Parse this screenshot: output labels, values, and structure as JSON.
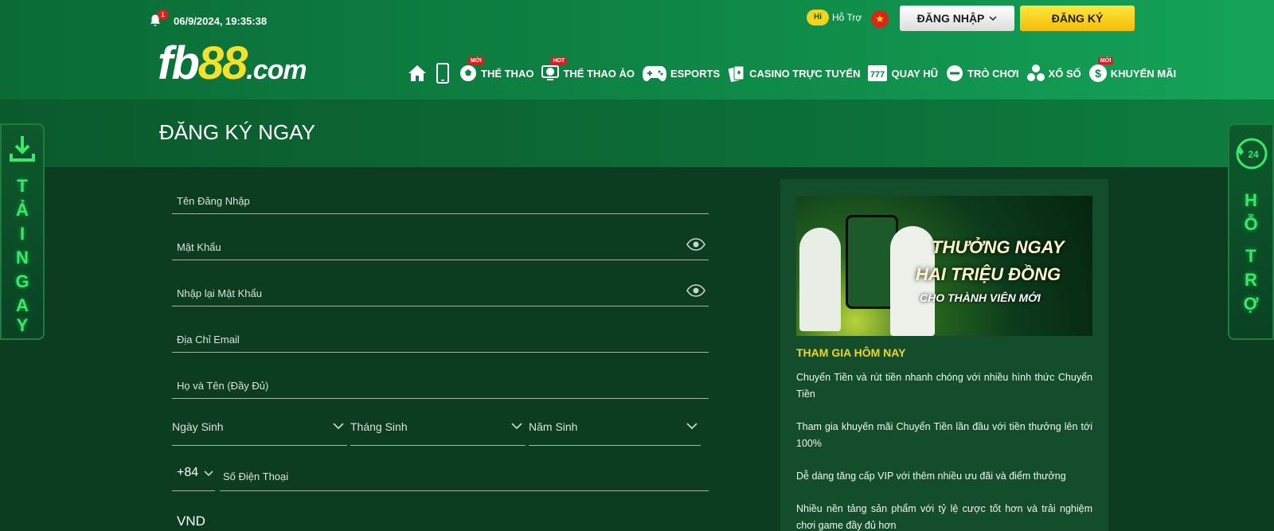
{
  "header": {
    "notification_count": "1",
    "datetime": "06/9/2024, 19:35:38",
    "support_badge": "Hi",
    "support_label": "Hỗ Trợ",
    "login_label": "ĐĂNG NHẬP",
    "register_label": "ĐĂNG KÝ",
    "logo": {
      "fb": "fb",
      "n88": "88",
      "com": ".com"
    }
  },
  "nav": [
    {
      "label": "THỂ THAO",
      "badge": "MỚI",
      "icon": "soccer-ball-icon"
    },
    {
      "label": "THỂ THAO ẢO",
      "badge": "HOT",
      "icon": "virtual-sports-icon"
    },
    {
      "label": "ESPORTS",
      "badge": "",
      "icon": "gamepad-icon"
    },
    {
      "label": "CASINO TRỰC TUYẾN",
      "badge": "",
      "icon": "cards-icon"
    },
    {
      "label": "QUAY HŨ",
      "badge": "",
      "icon": "slot-777-icon"
    },
    {
      "label": "TRÒ CHƠI",
      "badge": "",
      "icon": "game-icon"
    },
    {
      "label": "XỔ SỐ",
      "badge": "",
      "icon": "lottery-balls-icon"
    },
    {
      "label": "KHUYẾN MÃI",
      "badge": "MỚI",
      "icon": "promo-coin-icon"
    }
  ],
  "page_title": "ĐĂNG KÝ NGAY",
  "form": {
    "username_placeholder": "Tên Đăng Nhập",
    "password_placeholder": "Mật Khẩu",
    "confirm_password_placeholder": "Nhập lại Mật Khẩu",
    "email_placeholder": "Địa Chỉ Email",
    "fullname_placeholder": "Họ và Tên (Đầy Đủ)",
    "birth_day": "Ngày Sinh",
    "birth_month": "Tháng Sinh",
    "birth_year": "Năm Sinh",
    "phone_code": "+84",
    "phone_placeholder": "Số Điện Thoại",
    "currency": "VND"
  },
  "panel": {
    "banner_line1": "THƯỞNG NGAY",
    "banner_line2": "HAI TRIỆU ĐỒNG",
    "banner_line3": "CHO THÀNH VIÊN MỚI",
    "join_title": "THAM GIA HÔM NAY",
    "paragraphs": [
      "Chuyển Tiền và rút tiền nhanh chóng với nhiều hình thức Chuyển Tiền",
      "Tham gia khuyến mãi Chuyển Tiền lần đầu với tiền thưởng lên tới 100%",
      "Dễ dàng tăng cấp VIP với thêm nhiều ưu đãi và điểm thưởng",
      "Nhiều nền tảng sản phẩm với tỷ lệ cược tốt hơn và trải nghiệm chơi game đầy đủ hơn"
    ]
  },
  "side_left": {
    "letters": [
      "T",
      "Ả",
      "I",
      "N",
      "G",
      "A",
      "Y"
    ]
  },
  "side_right": {
    "badge": "24",
    "letters": [
      "H",
      "Ỗ",
      "T",
      "R",
      "Ợ"
    ]
  },
  "colors": {
    "accent_yellow": "#f6d41c",
    "brand_green": "#0e8444",
    "side_glow": "#3ce86a"
  }
}
